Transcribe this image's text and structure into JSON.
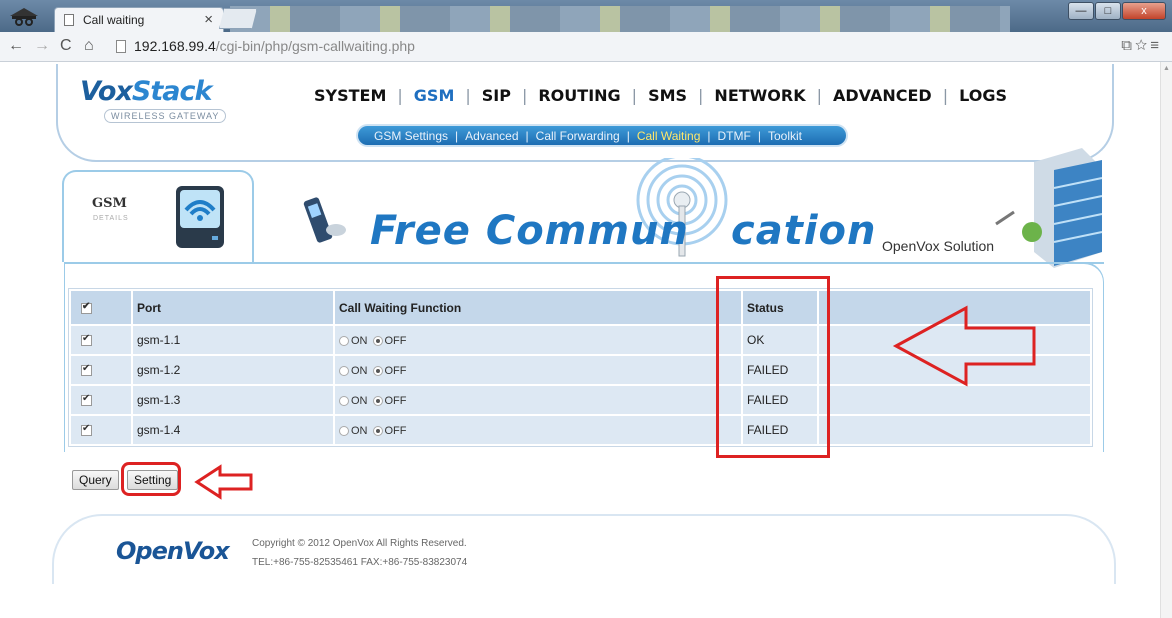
{
  "browser": {
    "tab_title": "Call waiting",
    "tab_close": "×",
    "url_host": "192.168.99.4",
    "url_path": "/cgi-bin/php/gsm-callwaiting.php",
    "win_minimize": "—",
    "win_maximize": "□",
    "win_close": "x"
  },
  "header": {
    "logo_a": "Vox",
    "logo_b": "Stack",
    "logo_sub": "WIRELESS GATEWAY",
    "nav": [
      "SYSTEM",
      "GSM",
      "SIP",
      "ROUTING",
      "SMS",
      "NETWORK",
      "ADVANCED",
      "LOGS"
    ],
    "nav_active": "GSM",
    "subnav": [
      "GSM Settings",
      "Advanced",
      "Call Forwarding",
      "Call Waiting",
      "DTMF",
      "Toolkit"
    ],
    "subnav_active": "Call Waiting"
  },
  "banner": {
    "gsm_title": "GSM",
    "gsm_sub": "DETAILS",
    "slogan_a": "Free Commun",
    "slogan_b": "cation",
    "openvox_solution": "OpenVox Solution"
  },
  "table": {
    "headers": [
      "Port",
      "Call Waiting Function",
      "Status"
    ],
    "on_label": "ON",
    "off_label": "OFF",
    "rows": [
      {
        "port": "gsm-1.1",
        "status": "OK",
        "checked": true,
        "value": "OFF"
      },
      {
        "port": "gsm-1.2",
        "status": "FAILED",
        "checked": true,
        "value": "OFF"
      },
      {
        "port": "gsm-1.3",
        "status": "FAILED",
        "checked": true,
        "value": "OFF"
      },
      {
        "port": "gsm-1.4",
        "status": "FAILED",
        "checked": true,
        "value": "OFF"
      }
    ]
  },
  "buttons": {
    "query": "Query",
    "setting": "Setting"
  },
  "footer": {
    "logo": "OpenVox",
    "copyright": "Copyright © 2012 OpenVox All Rights Reserved.",
    "contact": "TEL:+86-755-82535461 FAX:+86-755-83823074"
  },
  "colors": {
    "accent": "#1f6fc0",
    "annotation": "#dd2222",
    "row_bg": "#dde8f3",
    "header_bg": "#c4d7ea"
  }
}
